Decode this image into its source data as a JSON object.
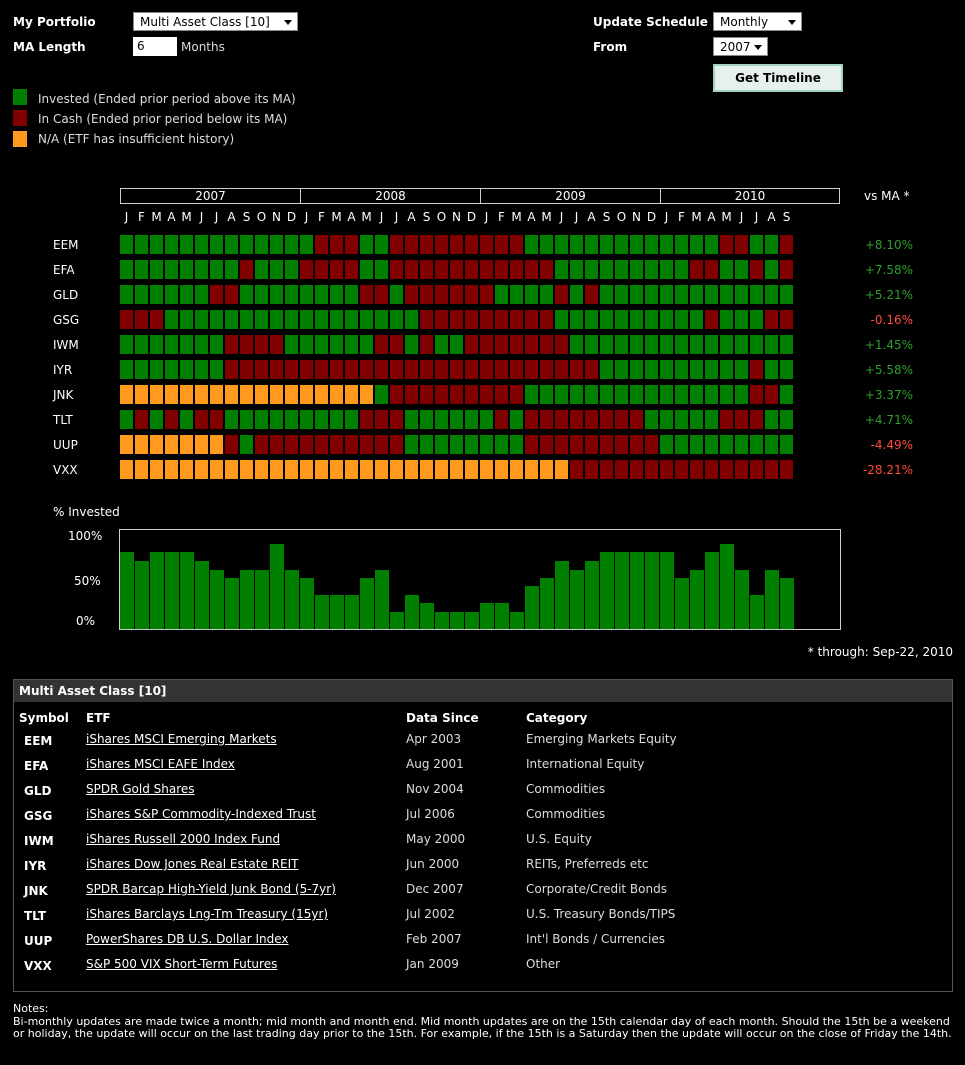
{
  "controls": {
    "portfolio_label": "My Portfolio",
    "portfolio_value": "Multi Asset Class [10]",
    "ma_label": "MA Length",
    "ma_value": "6",
    "ma_unit": "Months",
    "schedule_label": "Update Schedule",
    "schedule_value": "Monthly",
    "from_label": "From",
    "from_value": "2007",
    "button_label": "Get Timeline"
  },
  "legend": [
    {
      "color": "#007f00",
      "text": "Invested (Ended prior period above its MA)"
    },
    {
      "color": "#800000",
      "text": "In Cash (Ended prior period below its MA)"
    },
    {
      "color": "#ff9a1f",
      "text": "N/A (ETF has insufficient history)"
    }
  ],
  "colors": {
    "G": "#007f00",
    "R": "#800000",
    "N": "#ff9a1f",
    "positive": "#2e9e2e",
    "negative": "#ff4b3a"
  },
  "timeline": {
    "years": [
      "2007",
      "2008",
      "2009",
      "2010"
    ],
    "months": [
      "J",
      "F",
      "M",
      "A",
      "M",
      "J",
      "J",
      "A",
      "S",
      "O",
      "N",
      "D",
      "J",
      "F",
      "M",
      "A",
      "M",
      "J",
      "J",
      "A",
      "S",
      "O",
      "N",
      "D",
      "J",
      "F",
      "M",
      "A",
      "M",
      "J",
      "J",
      "A",
      "S",
      "O",
      "N",
      "D",
      "J",
      "F",
      "M",
      "A",
      "M",
      "J",
      "J",
      "A",
      "S"
    ],
    "vs_ma_header": "vs MA *",
    "rows": [
      {
        "symbol": "EEM",
        "cells": "GGGGGGGGGGGGGRRRGGRRRRRRRRRGGGGGGGGGGGGGRRGGRRG",
        "vs_ma": "+8.10%",
        "sign": "positive"
      },
      {
        "symbol": "EFA",
        "cells": "GGGGGGGGRGGGRRRRGGRRRRRRRRRRRGGGGGGGGGRRGGRGR",
        "vs_ma": "+7.58%",
        "sign": "positive"
      },
      {
        "symbol": "GLD",
        "cells": "GGGGGGRRGGGGGGGGRRGRRRRRRGGGGRGRGGGGGGGGGGGGG",
        "vs_ma": "+5.21%",
        "sign": "positive"
      },
      {
        "symbol": "GSG",
        "cells": "RRRGGGGGGGGGGGGGGGGGRRRRRRRRRGGGGGGGGGGRGGGRRR",
        "vs_ma": "-0.16%",
        "sign": "negative"
      },
      {
        "symbol": "IWM",
        "cells": "GGGGGGGRRRRGGGGGGRRGRGGRRRRRRRGGGGGGGGGGGGGGGG",
        "vs_ma": "+1.45%",
        "sign": "positive"
      },
      {
        "symbol": "IYR",
        "cells": "GGGGGGGRRRRRRRRRRRRRRRRRRRRRRRRRGGGGGGGGGGRGG",
        "vs_ma": "+5.58%",
        "sign": "positive"
      },
      {
        "symbol": "JNK",
        "cells": "NNNNNNNNNNNNNNNNNGRRRRRRRRRGGGGGGGGGGGGGGGRRG",
        "vs_ma": "+3.37%",
        "sign": "positive"
      },
      {
        "symbol": "TLT",
        "cells": "GRGRGRRGGGGGGGGGRRRGGGGGGRGRRRRRRRRGGGGGRRRGGG",
        "vs_ma": "+4.71%",
        "sign": "positive"
      },
      {
        "symbol": "UUP",
        "cells": "NNNNNNNRGRRRRRRRRRRGGGGGGGGRRRRRRRRRGGGGGGGGGRR",
        "vs_ma": "-4.49%",
        "sign": "negative"
      },
      {
        "symbol": "VXX",
        "cells": "NNNNNNNNNNNNNNNNNNNNNNNNNNNNNNRRRRRRRRRRRRRRRRGGR",
        "vs_ma": "-28.21%",
        "sign": "negative"
      }
    ]
  },
  "invested_chart": {
    "title": "% Invested",
    "y_labels": [
      "100%",
      "50%",
      "0%"
    ],
    "values": [
      90,
      80,
      90,
      90,
      90,
      80,
      70,
      60,
      70,
      70,
      100,
      70,
      60,
      40,
      40,
      40,
      60,
      70,
      20,
      40,
      30,
      20,
      20,
      20,
      30,
      30,
      20,
      50,
      60,
      80,
      70,
      80,
      90,
      90,
      90,
      90,
      90,
      60,
      70,
      90,
      100,
      70,
      40,
      70,
      60
    ]
  },
  "through_note": "* through: Sep-22, 2010",
  "portfolio_table": {
    "title": "Multi Asset Class [10]",
    "headers": {
      "symbol": "Symbol",
      "etf": "ETF",
      "since": "Data Since",
      "category": "Category"
    },
    "rows": [
      {
        "symbol": "EEM",
        "etf": "iShares MSCI Emerging Markets",
        "since": "Apr 2003",
        "category": "Emerging Markets Equity"
      },
      {
        "symbol": "EFA",
        "etf": "iShares MSCI EAFE Index",
        "since": "Aug 2001",
        "category": "International Equity"
      },
      {
        "symbol": "GLD",
        "etf": "SPDR Gold Shares",
        "since": "Nov 2004",
        "category": "Commodities"
      },
      {
        "symbol": "GSG",
        "etf": "iShares S&P Commodity-Indexed Trust",
        "since": "Jul 2006",
        "category": "Commodities"
      },
      {
        "symbol": "IWM",
        "etf": "iShares Russell 2000 Index Fund",
        "since": "May 2000",
        "category": "U.S. Equity"
      },
      {
        "symbol": "IYR",
        "etf": "iShares Dow Jones Real Estate REIT",
        "since": "Jun 2000",
        "category": "REITs, Preferreds etc"
      },
      {
        "symbol": "JNK",
        "etf": "SPDR Barcap High-Yield Junk Bond (5-7yr)",
        "since": "Dec 2007",
        "category": "Corporate/Credit Bonds"
      },
      {
        "symbol": "TLT",
        "etf": "iShares Barclays Lng-Tm Treasury (15yr)",
        "since": "Jul 2002",
        "category": "U.S. Treasury Bonds/TIPS"
      },
      {
        "symbol": "UUP",
        "etf": "PowerShares DB U.S. Dollar Index",
        "since": "Feb 2007",
        "category": "Int'l Bonds / Currencies"
      },
      {
        "symbol": "VXX",
        "etf": "S&P 500 VIX Short-Term Futures",
        "since": "Jan 2009",
        "category": "Other"
      }
    ]
  },
  "notes": {
    "heading": "Notes:",
    "text": "Bi-monthly updates are made twice a month; mid month and month end. Mid month updates are on the 15th calendar day of each month. Should the 15th be a weekend or holiday, the update will occur on the last trading day prior to the 15th. For example, if the 15th is a Saturday then the update will occur on the close of Friday the 14th."
  }
}
